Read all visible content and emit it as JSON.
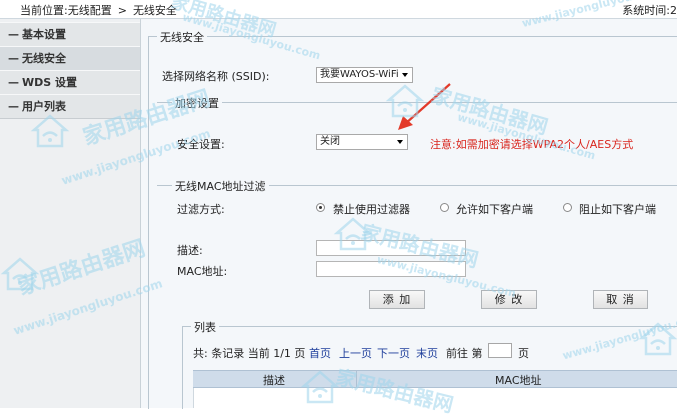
{
  "header": {
    "breadcrumb_prefix": "当前位置:无线配置",
    "breadcrumb_sep": ">",
    "breadcrumb_current": "无线安全",
    "system_time_label": "系统时间:2"
  },
  "sidebar": {
    "items": [
      {
        "label": "基本设置"
      },
      {
        "label": "无线安全"
      },
      {
        "label": "WDS 设置"
      },
      {
        "label": "用户列表"
      }
    ],
    "dash": "—"
  },
  "wireless_security": {
    "title": "无线安全",
    "ssid_label": "选择网络名称 (SSID):",
    "ssid_value": "我要WAYOS-WiFi",
    "encryption_legend": "加密设置",
    "security_label": "安全设置:",
    "security_value": "关闭",
    "note": "注意:如需加密请选择WPA2个人/AES方式"
  },
  "mac_filter": {
    "legend": "无线MAC地址过滤",
    "filter_label": "过滤方式:",
    "options": [
      {
        "label": "禁止使用过滤器",
        "checked": true
      },
      {
        "label": "允许如下客户端",
        "checked": false
      },
      {
        "label": "阻止如下客户端",
        "checked": false
      }
    ],
    "desc_label": "描述:",
    "mac_label": "MAC地址:",
    "add_button": "添 加",
    "edit_button": "修 改",
    "cancel_button": "取 消"
  },
  "list": {
    "legend": "列表",
    "summary": "共: 条记录 当前 1/1 页",
    "first": "首页",
    "prev": "上一页",
    "next": "下一页",
    "last": "末页",
    "goto_label": "前往 第",
    "page_suffix": "页",
    "col_desc": "描述",
    "col_mac": "MAC地址"
  },
  "watermarks": [
    {
      "text": "家用路由器网"
    },
    {
      "text": "www.jiayongluyou.com"
    }
  ],
  "colors": {
    "note_red": "#d9251d",
    "link_blue": "#1f3f9c",
    "table_header": "#cfdcea",
    "watermark": "#9fd5ec",
    "annotation_arrow": "#e33a2a"
  }
}
